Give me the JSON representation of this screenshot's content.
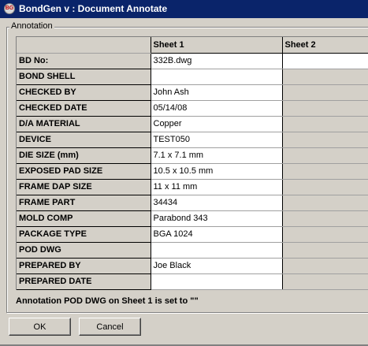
{
  "window": {
    "title": "BondGen v : Document Annotate",
    "icon": "app-logo-icon",
    "icon_text": "BG"
  },
  "group": {
    "label": "Annotation"
  },
  "grid": {
    "columns": [
      "Sheet 1",
      "Sheet 2"
    ],
    "rows": [
      {
        "label": "BD No:",
        "sheet1": "332B.dwg",
        "sheet2": ""
      },
      {
        "label": "BOND SHELL",
        "sheet1": "",
        "sheet2": ""
      },
      {
        "label": "CHECKED BY",
        "sheet1": "John Ash",
        "sheet2": ""
      },
      {
        "label": "CHECKED DATE",
        "sheet1": "05/14/08",
        "sheet2": ""
      },
      {
        "label": "D/A MATERIAL",
        "sheet1": "Copper",
        "sheet2": ""
      },
      {
        "label": "DEVICE",
        "sheet1": "TEST050",
        "sheet2": ""
      },
      {
        "label": "DIE SIZE (mm)",
        "sheet1": "7.1 x 7.1 mm",
        "sheet2": ""
      },
      {
        "label": "EXPOSED PAD SIZE",
        "sheet1": "10.5 x 10.5 mm",
        "sheet2": ""
      },
      {
        "label": "FRAME DAP SIZE",
        "sheet1": "11 x 11 mm",
        "sheet2": ""
      },
      {
        "label": "FRAME PART",
        "sheet1": "34434",
        "sheet2": ""
      },
      {
        "label": "MOLD COMP",
        "sheet1": "Parabond 343",
        "sheet2": ""
      },
      {
        "label": "PACKAGE TYPE",
        "sheet1": "BGA 1024",
        "sheet2": ""
      },
      {
        "label": "POD DWG",
        "sheet1": "",
        "sheet2": ""
      },
      {
        "label": "PREPARED BY",
        "sheet1": "Joe Black",
        "sheet2": ""
      },
      {
        "label": "PREPARED DATE",
        "sheet1": "",
        "sheet2": ""
      }
    ]
  },
  "status": "Annotation POD DWG on Sheet 1 is set to \"\"",
  "buttons": {
    "ok": "OK",
    "cancel": "Cancel"
  },
  "colors": {
    "titlebar": "#0a246a",
    "face": "#d4d0c8",
    "cell": "#ffffff"
  }
}
